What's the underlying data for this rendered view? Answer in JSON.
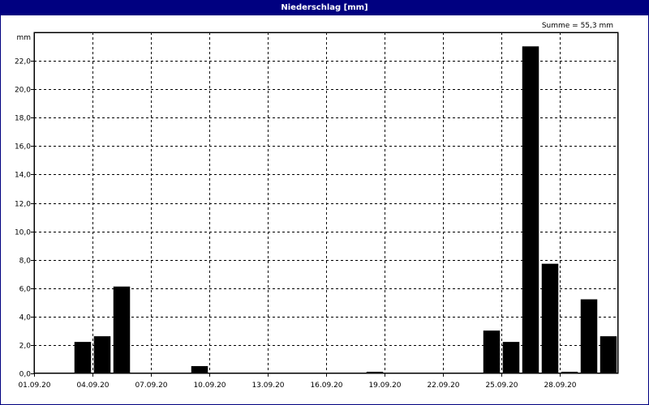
{
  "window": {
    "title": "Niederschlag [mm]"
  },
  "chart_data": {
    "type": "bar",
    "title": "Niederschlag [mm]",
    "ylabel": "mm",
    "annotation": "Summe = 55,3 mm",
    "ylim": [
      0,
      24
    ],
    "y_ticks": [
      "0,0",
      "2,0",
      "4,0",
      "6,0",
      "8,0",
      "10,0",
      "12,0",
      "14,0",
      "16,0",
      "18,0",
      "20,0",
      "22,0"
    ],
    "x_tick_labels": [
      "01.09.20",
      "04.09.20",
      "07.09.20",
      "10.09.20",
      "13.09.20",
      "16.09.20",
      "19.09.20",
      "22.09.20",
      "25.09.20",
      "28.09.20"
    ],
    "categories": [
      "01.09.20",
      "02.09.20",
      "03.09.20",
      "04.09.20",
      "05.09.20",
      "06.09.20",
      "07.09.20",
      "08.09.20",
      "09.09.20",
      "10.09.20",
      "11.09.20",
      "12.09.20",
      "13.09.20",
      "14.09.20",
      "15.09.20",
      "16.09.20",
      "17.09.20",
      "18.09.20",
      "19.09.20",
      "20.09.20",
      "21.09.20",
      "22.09.20",
      "23.09.20",
      "24.09.20",
      "25.09.20",
      "26.09.20",
      "27.09.20",
      "28.09.20",
      "29.09.20",
      "30.09.20"
    ],
    "values": [
      0,
      0,
      2.2,
      2.6,
      6.1,
      0,
      0,
      0,
      0.5,
      0,
      0,
      0,
      0,
      0,
      0,
      0,
      0,
      0.1,
      0,
      0,
      0,
      0,
      0,
      3.0,
      2.2,
      23.0,
      7.7,
      0.1,
      5.2,
      2.6
    ],
    "grid": true,
    "bar_color": "#000000"
  }
}
